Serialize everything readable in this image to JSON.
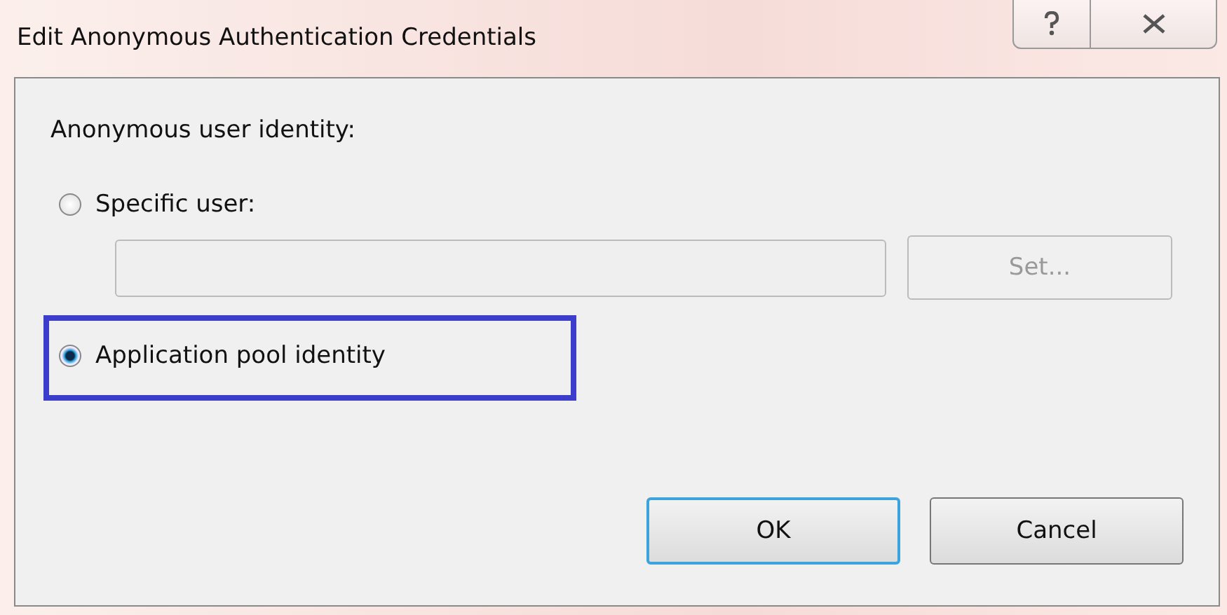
{
  "window": {
    "title": "Edit Anonymous Authentication Credentials"
  },
  "group_label": "Anonymous user identity:",
  "options": [
    {
      "label": "Specific user:",
      "selected": false,
      "highlighted": false,
      "field": {
        "disabled": true
      },
      "button": {
        "label": "Set...",
        "disabled": true
      }
    },
    {
      "label": "Application pool identity",
      "selected": true,
      "highlighted": true
    }
  ],
  "buttons": [
    {
      "label": "OK",
      "default": true
    },
    {
      "label": "Cancel",
      "default": false
    }
  ]
}
